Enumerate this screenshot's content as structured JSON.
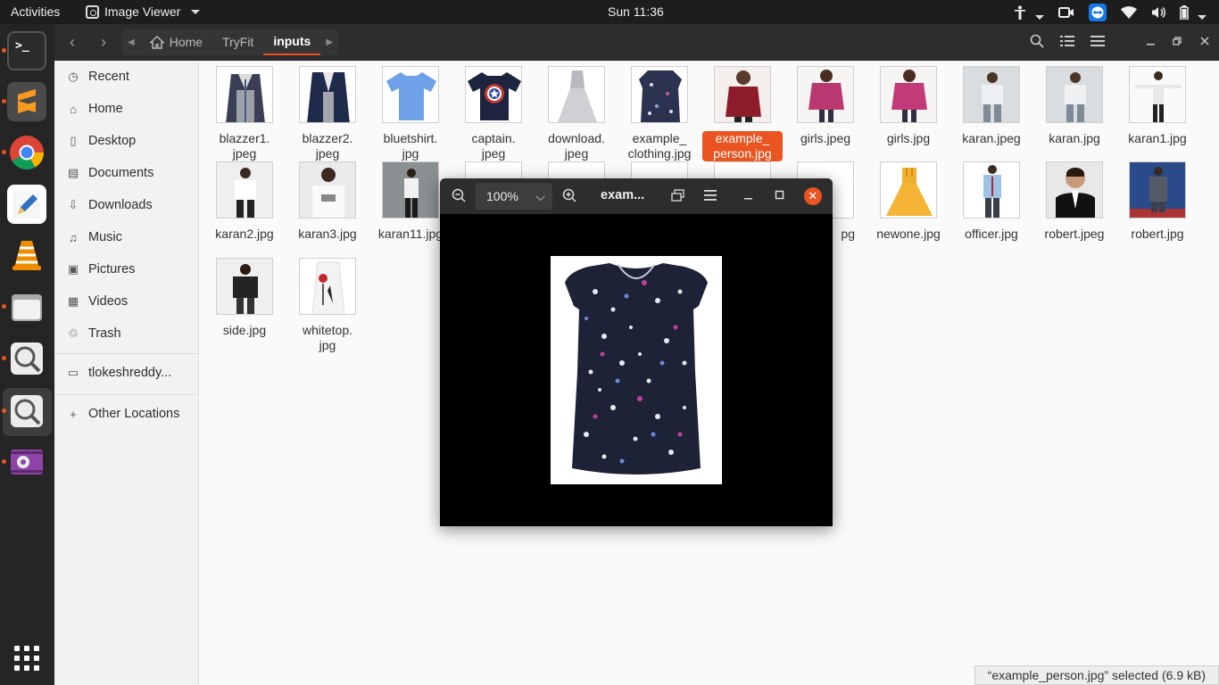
{
  "topbar": {
    "activities": "Activities",
    "app_name": "Image Viewer",
    "clock": "Sun 11:36"
  },
  "headerbar": {
    "path": [
      "Home",
      "TryFit",
      "inputs"
    ]
  },
  "sidebar": {
    "items": [
      {
        "label": "Recent",
        "icon": "clock-icon"
      },
      {
        "label": "Home",
        "icon": "home-icon"
      },
      {
        "label": "Desktop",
        "icon": "desktop-icon"
      },
      {
        "label": "Documents",
        "icon": "document-icon"
      },
      {
        "label": "Downloads",
        "icon": "download-icon"
      },
      {
        "label": "Music",
        "icon": "music-icon"
      },
      {
        "label": "Pictures",
        "icon": "pictures-icon"
      },
      {
        "label": "Videos",
        "icon": "video-icon"
      },
      {
        "label": "Trash",
        "icon": "trash-icon"
      }
    ],
    "drive": "tlokeshreddy...",
    "other_locations": "Other Locations"
  },
  "files": [
    {
      "name": "blazzer1.\njpeg"
    },
    {
      "name": "blazzer2.\njpeg"
    },
    {
      "name": "bluetshirt.\njpg"
    },
    {
      "name": "captain.\njpeg"
    },
    {
      "name": "download.\njpeg"
    },
    {
      "name": "example_\nclothing.jpg"
    },
    {
      "name": "example_\nperson.jpg",
      "selected": true
    },
    {
      "name": "girls.jpeg"
    },
    {
      "name": "girls.jpg"
    },
    {
      "name": "karan.jpeg"
    },
    {
      "name": "karan.jpg"
    },
    {
      "name": "karan1.jpg"
    },
    {
      "name": "karan2.jpg"
    },
    {
      "name": "karan3.jpg"
    },
    {
      "name": "karan11.jpg"
    },
    {
      "name": ""
    },
    {
      "name": ""
    },
    {
      "name": ""
    },
    {
      "name": ""
    },
    {
      "name": "pg"
    },
    {
      "name": "newone.jpg"
    },
    {
      "name": "officer.jpg"
    },
    {
      "name": "robert.jpeg"
    },
    {
      "name": "robert.jpg"
    },
    {
      "name": "side.jpg"
    },
    {
      "name": "whitetop.\njpg"
    }
  ],
  "status": "“example_person.jpg” selected  (6.9 kB)",
  "viewer": {
    "zoom": "100%",
    "title": "exam..."
  }
}
